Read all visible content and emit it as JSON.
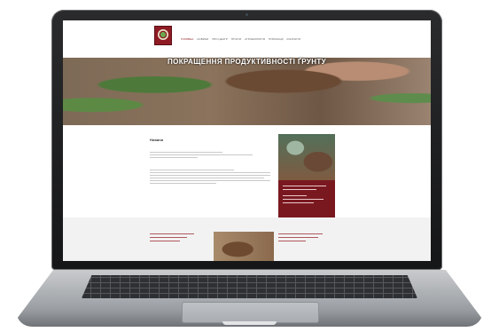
{
  "header": {
    "logo_caption": "",
    "tagline": "",
    "nav": [
      "Головна",
      "Новини",
      "Про центр",
      "Ґрунти",
      "Агроекологія",
      "Публікації",
      "Контакти"
    ]
  },
  "hero": {
    "title": "ПОКРАЩЕННЯ ПРОДУКТИВНОСТІ ҐРУНТУ",
    "subtitle": ""
  },
  "news": {
    "heading": "Новини",
    "more": ""
  },
  "band": {
    "label": "",
    "label2": ""
  },
  "colors": {
    "accent": "#8f1b24",
    "hero_overlay": "#ffffff"
  }
}
